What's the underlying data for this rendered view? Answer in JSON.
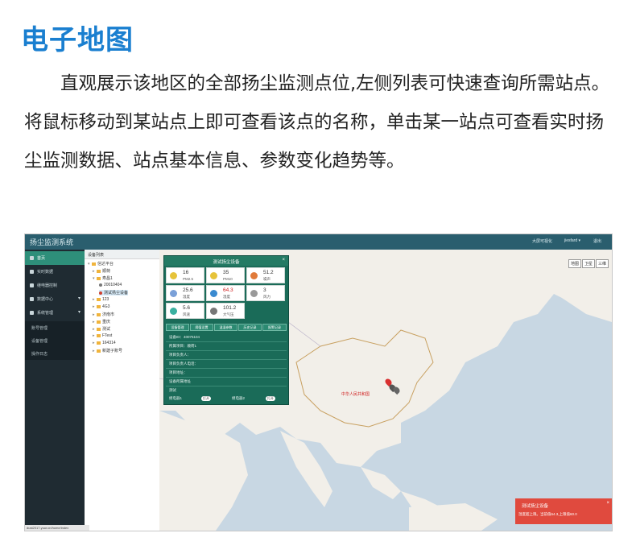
{
  "heading": "电子地图",
  "description": "直观展示该地区的全部扬尘监测点位,左侧列表可快速查询所需站点。将鼠标移动到某站点上即可查看该点的名称，单击某一站点可查看实时扬尘监测数据、站点基本信息、参数变化趋势等。",
  "app": {
    "title": "扬尘监测系统",
    "topbar_menu": [
      "大屏可视化",
      "jiesfard ▾",
      "退出"
    ],
    "sidebar": [
      {
        "label": "首页",
        "icon": "home-icon",
        "active": true
      },
      {
        "label": "实时数据",
        "icon": "chart-icon",
        "active": false
      },
      {
        "label": "继电器控制",
        "icon": "relay-icon",
        "active": false
      },
      {
        "label": "数据中心",
        "icon": "database-icon",
        "active": false
      },
      {
        "label": "系统管理",
        "icon": "settings-icon",
        "active": false
      }
    ],
    "sidebar_sub": [
      "账号管理",
      "设备管理",
      "操作日志"
    ],
    "tree": {
      "header": "设备列表",
      "nodes": [
        "信达平台",
        "顺荷",
        "寿昌1",
        "20010404",
        "测试扬尘设备",
        "123",
        "4G3",
        "济南市",
        "重庆",
        "测试",
        "FTest",
        "164314",
        "新建子账号"
      ]
    },
    "map": {
      "controls": [
        "地图",
        "卫星",
        "三维"
      ],
      "china_label": "中华人民共和国"
    },
    "popup": {
      "title": "测试扬尘设备",
      "cells": [
        {
          "value": "16",
          "label": "PM2.5",
          "icon": "pm25-icon",
          "color": "#e6c33a"
        },
        {
          "value": "35",
          "label": "PM10",
          "icon": "pm10-icon",
          "color": "#e6c33a"
        },
        {
          "value": "51.2",
          "label": "噪声",
          "icon": "speaker-icon",
          "color": "#e07a3a"
        },
        {
          "value": "25.6",
          "label": "温度",
          "icon": "thermometer-icon",
          "color": "#7aa0d8"
        },
        {
          "value": "64.3",
          "label": "湿度",
          "icon": "humidity-icon",
          "color": "#3a8ad0",
          "red": true
        },
        {
          "value": "3",
          "label": "风力",
          "icon": "wind-icon",
          "color": "#999999"
        },
        {
          "value": "5.6",
          "label": "风速",
          "icon": "windspeed-icon",
          "color": "#3ab0a0"
        },
        {
          "value": "101.2",
          "label": "大气压",
          "icon": "pressure-icon",
          "color": "#777777"
        }
      ],
      "tabs": [
        "设备管理",
        "阈值设置",
        "温湿参数",
        "历史记录",
        "报警记录"
      ],
      "rows": [
        "设备ID：40075104",
        "所属项目：顺荷1",
        "项目负责人：",
        "项目负责人电话：",
        "项目地址：",
        "设备所属地址"
      ],
      "footer_label": "测试",
      "relay1_label": "继电器1",
      "relay1_btn": "打开",
      "relay2_label": "继电器2",
      "relay2_btn": "打开"
    },
    "toast": {
      "title": "测试扬尘设备",
      "message": "湿度超上限。当前值64.3,上限值60.0"
    },
    "status_url": "dust2017.yuur.cn/home/index"
  }
}
